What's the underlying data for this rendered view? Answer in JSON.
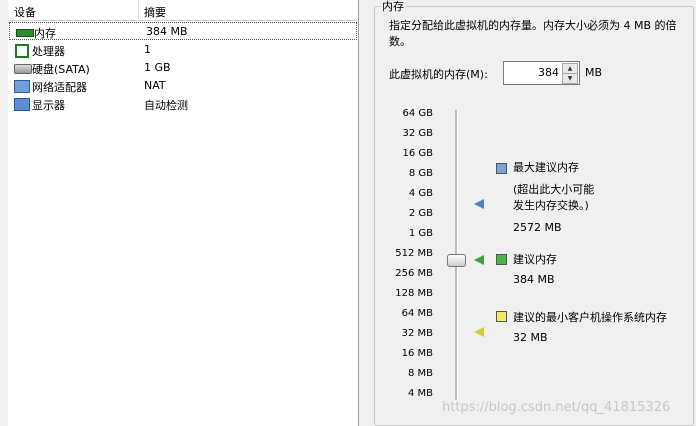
{
  "devices": {
    "header_device": "设备",
    "header_summary": "摘要",
    "rows": [
      {
        "name": "内存",
        "value": "384 MB",
        "icon": "memory-icon"
      },
      {
        "name": "处理器",
        "value": "1",
        "icon": "cpu-icon"
      },
      {
        "name": "硬盘(SATA)",
        "value": "1 GB",
        "icon": "harddisk-icon"
      },
      {
        "name": "网络适配器",
        "value": "NAT",
        "icon": "network-icon"
      },
      {
        "name": "显示器",
        "value": "自动检测",
        "icon": "display-icon"
      }
    ]
  },
  "memory": {
    "group_title": "内存",
    "description": "指定分配给此虚拟机的内存量。内存大小必须为 4 MB 的倍数。",
    "field_label": "此虚拟机的内存(M):",
    "field_value": "384",
    "field_unit": "MB",
    "scale": [
      "64 GB",
      "32 GB",
      "16 GB",
      "8 GB",
      "4 GB",
      "2 GB",
      "1 GB",
      "512 MB",
      "256 MB",
      "128 MB",
      "64 MB",
      "32 MB",
      "16 MB",
      "8 MB",
      "4 MB"
    ],
    "slider_value_mb": 384,
    "max_title": "最大建议内存",
    "max_note_line1": "(超出此大小可能",
    "max_note_line2": "发生内存交换。)",
    "max_value": "2572 MB",
    "rec_title": "建议内存",
    "rec_value": "384 MB",
    "min_title": "建议的最小客户机操作系统内存",
    "min_value": "32 MB",
    "colors": {
      "max": "#7aa3d8",
      "recommended": "#48b548",
      "minimum": "#f1ea6a"
    }
  },
  "watermark": "https://blog.csdn.net/qq_41815326"
}
